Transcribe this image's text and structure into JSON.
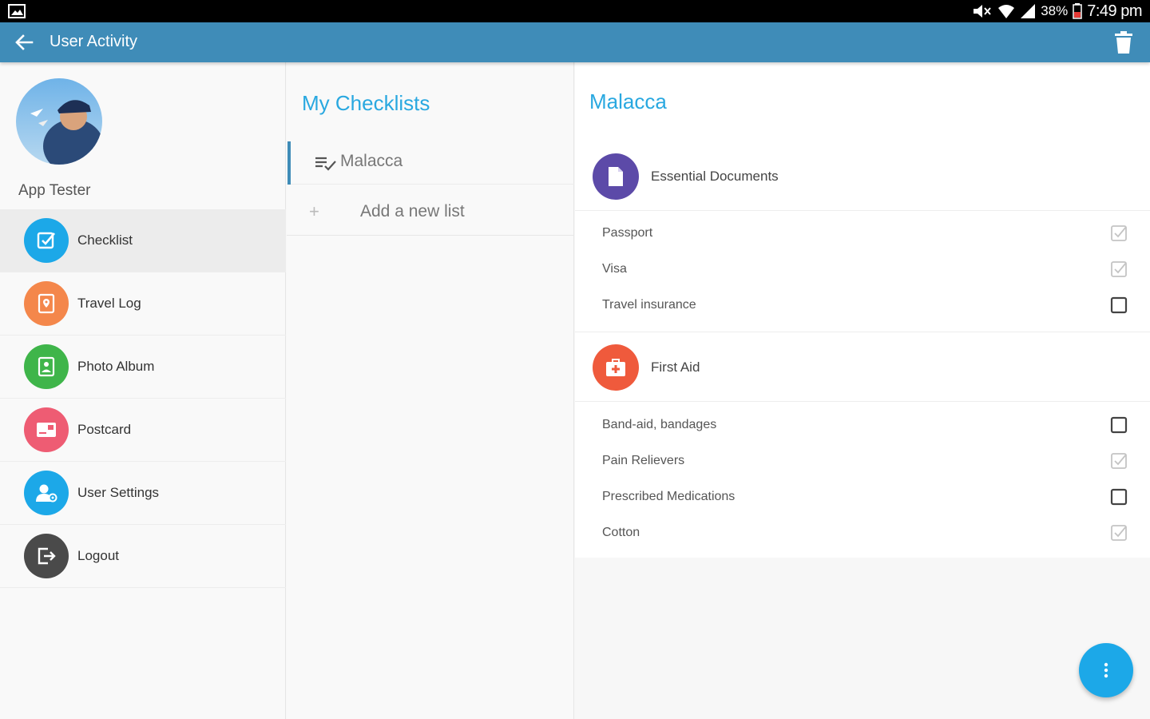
{
  "status_bar": {
    "battery_percent": "38%",
    "time": "7:49 pm",
    "icons": [
      "gallery-icon",
      "mute-icon",
      "wifi-icon",
      "signal-icon",
      "battery-low-icon"
    ]
  },
  "app_bar": {
    "title": "User Activity",
    "back_icon": "arrow-left-icon",
    "delete_icon": "trash-icon",
    "color": "#3f8cb8"
  },
  "sidebar": {
    "user_name": "App Tester",
    "items": [
      {
        "label": "Checklist",
        "icon": "checklist-icon",
        "color": "#1ca8e8",
        "active": true
      },
      {
        "label": "Travel Log",
        "icon": "travel-log-icon",
        "color": "#f4874b",
        "active": false
      },
      {
        "label": "Photo Album",
        "icon": "photo-album-icon",
        "color": "#3fb54a",
        "active": false
      },
      {
        "label": "Postcard",
        "icon": "postcard-icon",
        "color": "#ee5c73",
        "active": false
      },
      {
        "label": "User Settings",
        "icon": "user-settings-icon",
        "color": "#1ca8e8",
        "active": false
      },
      {
        "label": "Logout",
        "icon": "logout-icon",
        "color": "#4a4a4a",
        "active": false
      }
    ]
  },
  "checklists": {
    "title": "My Checklists",
    "lists": [
      {
        "label": "Malacca",
        "selected": true
      }
    ],
    "add_label": "Add a new list"
  },
  "detail": {
    "title": "Malacca",
    "sections": [
      {
        "title": "Essential Documents",
        "icon": "document-icon",
        "color": "#5c4aa8",
        "items": [
          {
            "label": "Passport",
            "checked": true
          },
          {
            "label": "Visa",
            "checked": true
          },
          {
            "label": "Travel insurance",
            "checked": false
          }
        ]
      },
      {
        "title": "First Aid",
        "icon": "first-aid-icon",
        "color": "#ef5a3c",
        "items": [
          {
            "label": "Band-aid, bandages",
            "checked": false
          },
          {
            "label": "Pain Relievers",
            "checked": true
          },
          {
            "label": "Prescribed Medications",
            "checked": false
          },
          {
            "label": "Cotton",
            "checked": true
          }
        ]
      }
    ]
  },
  "fab": {
    "icon": "more-vertical-icon",
    "color": "#1ca8e8"
  }
}
